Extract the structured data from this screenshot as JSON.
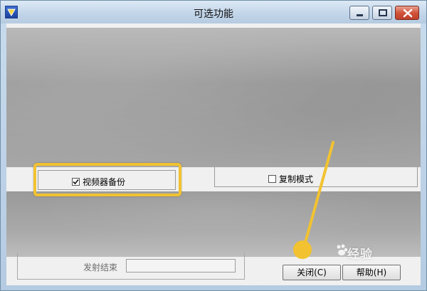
{
  "window": {
    "title": "可选功能",
    "icon": "app-logo-icon",
    "controls": [
      "minimize-icon",
      "maximize-icon",
      "close-icon"
    ]
  },
  "options": {
    "video_backup": {
      "label": "视频器备份",
      "checked": true
    },
    "copy_mode": {
      "label": "复制模式",
      "checked": false
    }
  },
  "send_end": {
    "label": "发射结束",
    "value": ""
  },
  "buttons": {
    "close_label": "关闭(C)",
    "help_label": "帮助(H)"
  },
  "watermark": {
    "text": "经验"
  },
  "colors": {
    "highlight": "#f2c230",
    "titlebar": "#c3d6ea",
    "close_button": "#c0402a"
  }
}
